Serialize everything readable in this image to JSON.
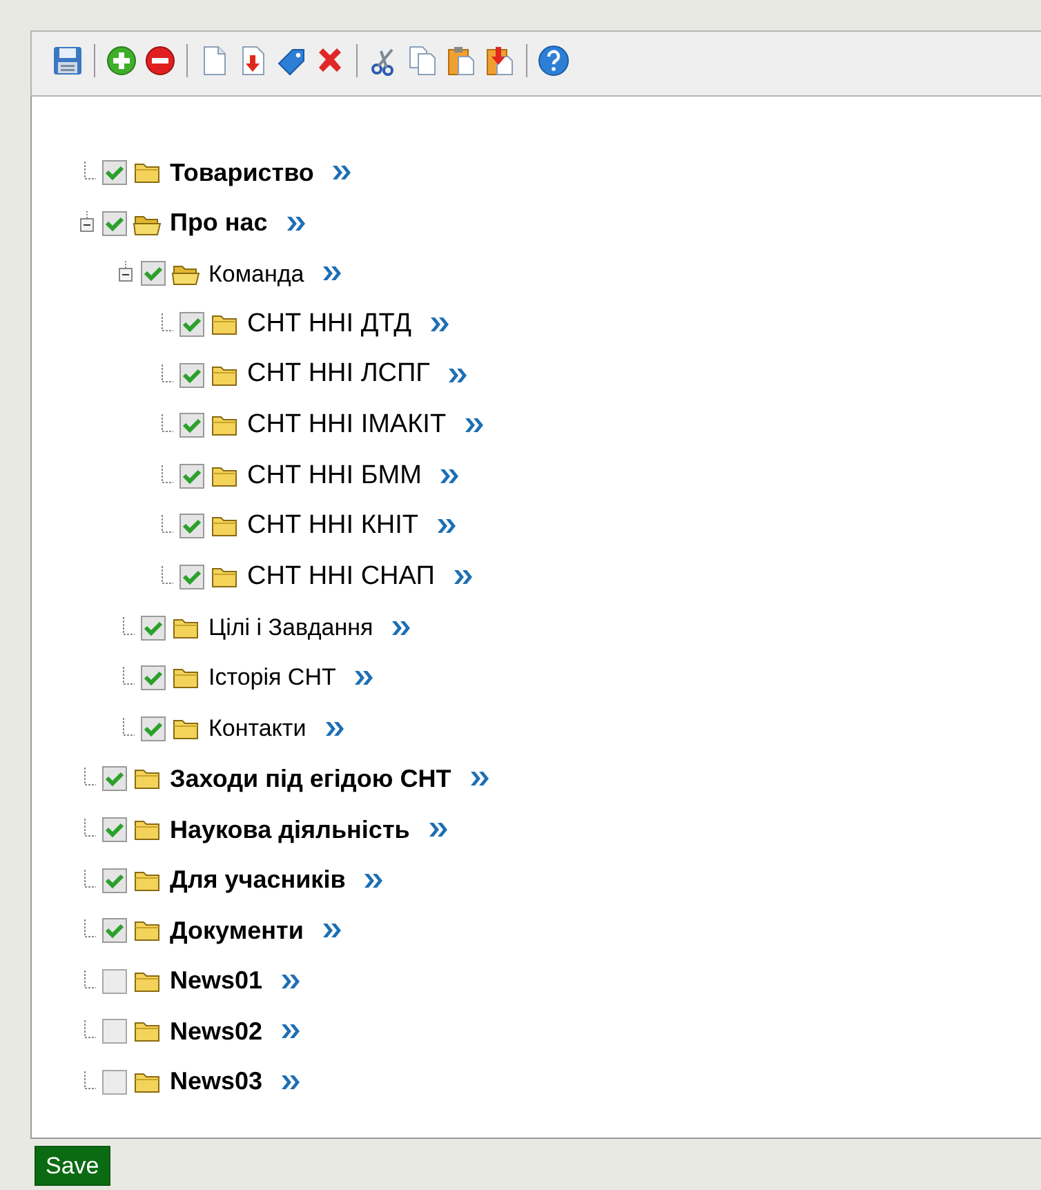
{
  "tree": [
    {
      "label": "Товариство",
      "checked": true
    },
    {
      "label": "Про нас",
      "checked": true,
      "expanded": true,
      "children": [
        {
          "label": "Команда",
          "checked": true,
          "expanded": true,
          "children": [
            {
              "label": "СНТ ННІ ДТД",
              "checked": true
            },
            {
              "label": "СНТ ННІ ЛСПГ",
              "checked": true
            },
            {
              "label": "СНТ ННІ ІМАКІТ",
              "checked": true
            },
            {
              "label": "СНТ ННІ БММ",
              "checked": true
            },
            {
              "label": "СНТ ННІ КНІТ",
              "checked": true
            },
            {
              "label": "СНТ ННІ СНАП",
              "checked": true
            }
          ]
        },
        {
          "label": "Цілі і Завдання",
          "checked": true
        },
        {
          "label": "Історія СНТ",
          "checked": true
        },
        {
          "label": "Контакти",
          "checked": true
        }
      ]
    },
    {
      "label": "Заходи під егідою СНТ",
      "checked": true
    },
    {
      "label": "Наукова діяльність",
      "checked": true
    },
    {
      "label": "Для учасників",
      "checked": true
    },
    {
      "label": "Документи",
      "checked": true
    },
    {
      "label": "News01",
      "checked": false
    },
    {
      "label": "News02",
      "checked": false
    },
    {
      "label": "News03",
      "checked": false
    }
  ],
  "save_button": "Save"
}
